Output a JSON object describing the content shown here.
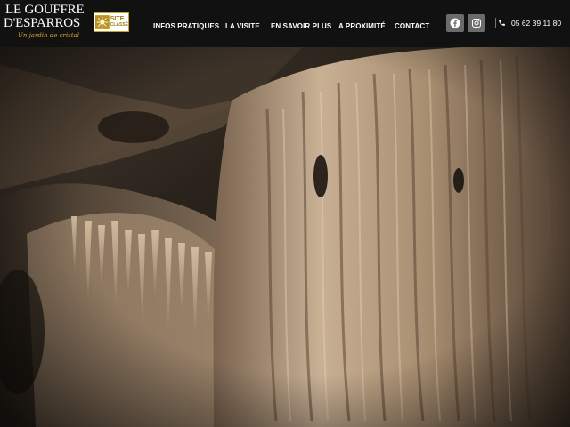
{
  "logo": {
    "line1": "LE GOUFFRE",
    "line2": "D'ESPARROS",
    "tagline": "Un jardin de cristal"
  },
  "badge": {
    "line1": "SITE",
    "line2": "CLASSÉ",
    "emblem": "sunburst-emblem"
  },
  "nav": [
    {
      "label": "INFOS PRATIQUES"
    },
    {
      "label": "LA VISITE"
    },
    {
      "label": "EN SAVOIR PLUS"
    },
    {
      "label": "A PROXIMITÉ"
    },
    {
      "label": "CONTACT"
    }
  ],
  "social": [
    {
      "icon": "facebook-icon"
    },
    {
      "icon": "instagram-icon"
    }
  ],
  "phone": {
    "icon": "phone-icon",
    "number": "05 62 39 11 80"
  },
  "hero": {
    "image": "cave-stalactite-formations-photo"
  },
  "colors": {
    "header_bg": "#111111",
    "nav_text": "#ffffff",
    "social_bg": "#6b6b6b",
    "tagline_gold": "#d4a52e"
  }
}
